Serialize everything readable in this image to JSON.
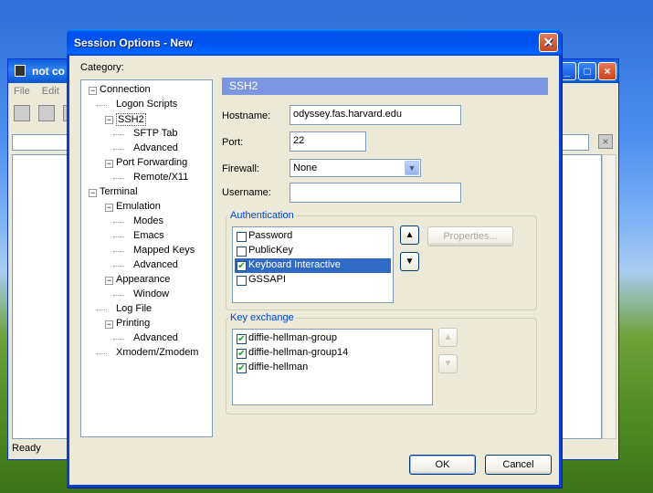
{
  "background_window": {
    "title": "not co",
    "menu": [
      "File",
      "Edit"
    ],
    "status": "Ready"
  },
  "dialog": {
    "title": "Session Options - New",
    "category_label": "Category:",
    "tree": [
      {
        "label": "Connection",
        "level": 0,
        "expander": "-"
      },
      {
        "label": "Logon Scripts",
        "level": 1
      },
      {
        "label": "SSH2",
        "level": 1,
        "expander": "-",
        "selected": true
      },
      {
        "label": "SFTP Tab",
        "level": 2
      },
      {
        "label": "Advanced",
        "level": 2
      },
      {
        "label": "Port Forwarding",
        "level": 1,
        "expander": "-"
      },
      {
        "label": "Remote/X11",
        "level": 2
      },
      {
        "label": "Terminal",
        "level": 0,
        "expander": "-"
      },
      {
        "label": "Emulation",
        "level": 1,
        "expander": "-"
      },
      {
        "label": "Modes",
        "level": 2
      },
      {
        "label": "Emacs",
        "level": 2
      },
      {
        "label": "Mapped Keys",
        "level": 2
      },
      {
        "label": "Advanced",
        "level": 2
      },
      {
        "label": "Appearance",
        "level": 1,
        "expander": "-"
      },
      {
        "label": "Window",
        "level": 2
      },
      {
        "label": "Log File",
        "level": 1
      },
      {
        "label": "Printing",
        "level": 1,
        "expander": "-"
      },
      {
        "label": "Advanced",
        "level": 2
      },
      {
        "label": "Xmodem/Zmodem",
        "level": 1
      }
    ],
    "panel_title": "SSH2",
    "hostname_label": "Hostname:",
    "hostname_value": "odyssey.fas.harvard.edu",
    "port_label": "Port:",
    "port_value": "22",
    "firewall_label": "Firewall:",
    "firewall_value": "None",
    "username_label": "Username:",
    "username_value": "",
    "auth_group": "Authentication",
    "auth_items": [
      {
        "label": "Password",
        "checked": false,
        "selected": false
      },
      {
        "label": "PublicKey",
        "checked": false,
        "selected": false
      },
      {
        "label": "Keyboard Interactive",
        "checked": true,
        "selected": true
      },
      {
        "label": "GSSAPI",
        "checked": false,
        "selected": false
      }
    ],
    "properties_label": "Properties...",
    "kex_group": "Key exchange",
    "kex_items": [
      {
        "label": "diffie-hellman-group",
        "checked": true
      },
      {
        "label": "diffie-hellman-group14",
        "checked": true
      },
      {
        "label": "diffie-hellman",
        "checked": true
      }
    ],
    "ok_label": "OK",
    "cancel_label": "Cancel"
  },
  "icons": {
    "up": "up-arrow-icon",
    "down": "down-arrow-icon",
    "check": "check-icon",
    "close": "close-icon"
  },
  "colors": {
    "title_bar": "#0053ee",
    "panel_header": "#7a96df",
    "selection": "#316ac5",
    "group_title": "#0046d5"
  }
}
